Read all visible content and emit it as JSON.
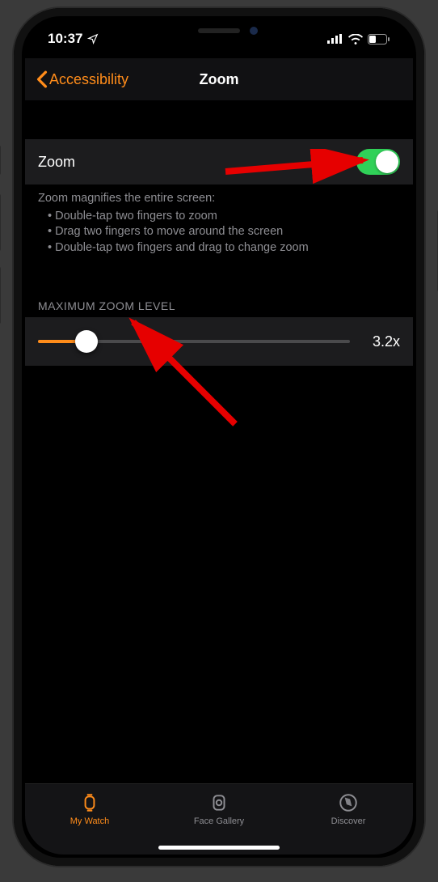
{
  "status": {
    "time": "10:37"
  },
  "nav": {
    "back_label": "Accessibility",
    "title": "Zoom"
  },
  "zoom_row": {
    "label": "Zoom",
    "enabled": true
  },
  "description": {
    "intro": "Zoom magnifies the entire screen:",
    "bullets": [
      "Double-tap two fingers to zoom",
      "Drag two fingers to move around the screen",
      "Double-tap two fingers and drag to change zoom"
    ]
  },
  "max_zoom": {
    "header": "MAXIMUM ZOOM LEVEL",
    "value_label": "3.2x",
    "fill_percent": 15.5
  },
  "tabs": [
    {
      "label": "My Watch",
      "active": true
    },
    {
      "label": "Face Gallery",
      "active": false
    },
    {
      "label": "Discover",
      "active": false
    }
  ]
}
